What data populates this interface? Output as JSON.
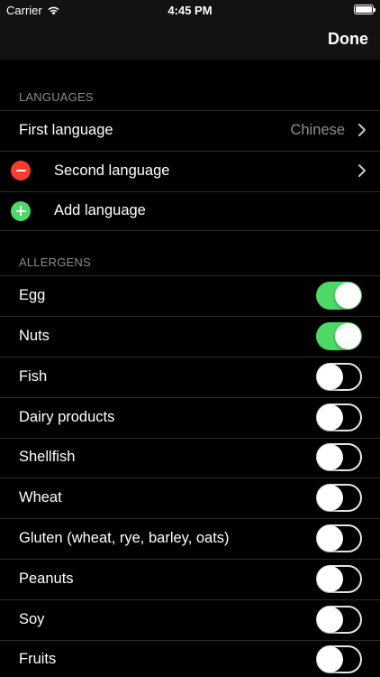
{
  "status_bar": {
    "carrier": "Carrier",
    "time": "4:45 PM",
    "wifi_icon": "wifi-icon",
    "battery_icon": "battery-icon"
  },
  "nav": {
    "done_label": "Done"
  },
  "languages": {
    "header": "LANGUAGES",
    "first": {
      "label": "First language",
      "value": "Chinese"
    },
    "second": {
      "label": "Second language"
    },
    "add": {
      "label": "Add language"
    }
  },
  "allergens": {
    "header": "ALLERGENS",
    "items": [
      {
        "label": "Egg",
        "enabled": true
      },
      {
        "label": "Nuts",
        "enabled": true
      },
      {
        "label": "Fish",
        "enabled": false
      },
      {
        "label": "Dairy products",
        "enabled": false
      },
      {
        "label": "Shellfish",
        "enabled": false
      },
      {
        "label": "Wheat",
        "enabled": false
      },
      {
        "label": "Gluten (wheat, rye, barley, oats)",
        "enabled": false
      },
      {
        "label": "Peanuts",
        "enabled": false
      },
      {
        "label": "Soy",
        "enabled": false
      },
      {
        "label": "Fruits",
        "enabled": false
      }
    ]
  },
  "colors": {
    "switch_on": "#4cd964",
    "remove": "#ff3b30",
    "add": "#4cd964",
    "secondary_text": "#8e8e93"
  }
}
